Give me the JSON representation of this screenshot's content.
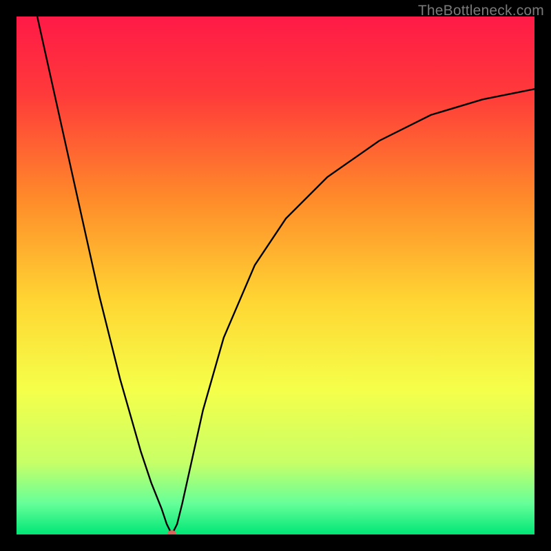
{
  "watermark": {
    "text": "TheBottleneck.com"
  },
  "chart_data": {
    "type": "line",
    "title": "",
    "xlabel": "",
    "ylabel": "",
    "xlim": [
      0,
      100
    ],
    "ylim": [
      0,
      100
    ],
    "gradient_stops": [
      {
        "offset": 0,
        "color": "#ff1a47"
      },
      {
        "offset": 15,
        "color": "#ff3a3a"
      },
      {
        "offset": 35,
        "color": "#ff8a2a"
      },
      {
        "offset": 55,
        "color": "#ffd633"
      },
      {
        "offset": 72,
        "color": "#f5ff4a"
      },
      {
        "offset": 86,
        "color": "#c8ff66"
      },
      {
        "offset": 94,
        "color": "#66ff99"
      },
      {
        "offset": 100,
        "color": "#00e676"
      }
    ],
    "series": [
      {
        "name": "bottleneck-curve",
        "x": [
          4,
          6,
          8,
          10,
          12,
          14,
          16,
          18,
          20,
          22,
          24,
          26,
          28,
          29,
          30,
          31,
          32,
          34,
          36,
          40,
          46,
          52,
          60,
          70,
          80,
          90,
          100
        ],
        "y": [
          100,
          91,
          82,
          73,
          64,
          55,
          46,
          38,
          30,
          23,
          16,
          10,
          5,
          2,
          0,
          2,
          6,
          15,
          24,
          38,
          52,
          61,
          69,
          76,
          81,
          84,
          86
        ]
      }
    ],
    "marker": {
      "x": 30,
      "y": 0,
      "color": "#d9645b",
      "rx": 6,
      "ry": 4
    },
    "annotations": []
  }
}
